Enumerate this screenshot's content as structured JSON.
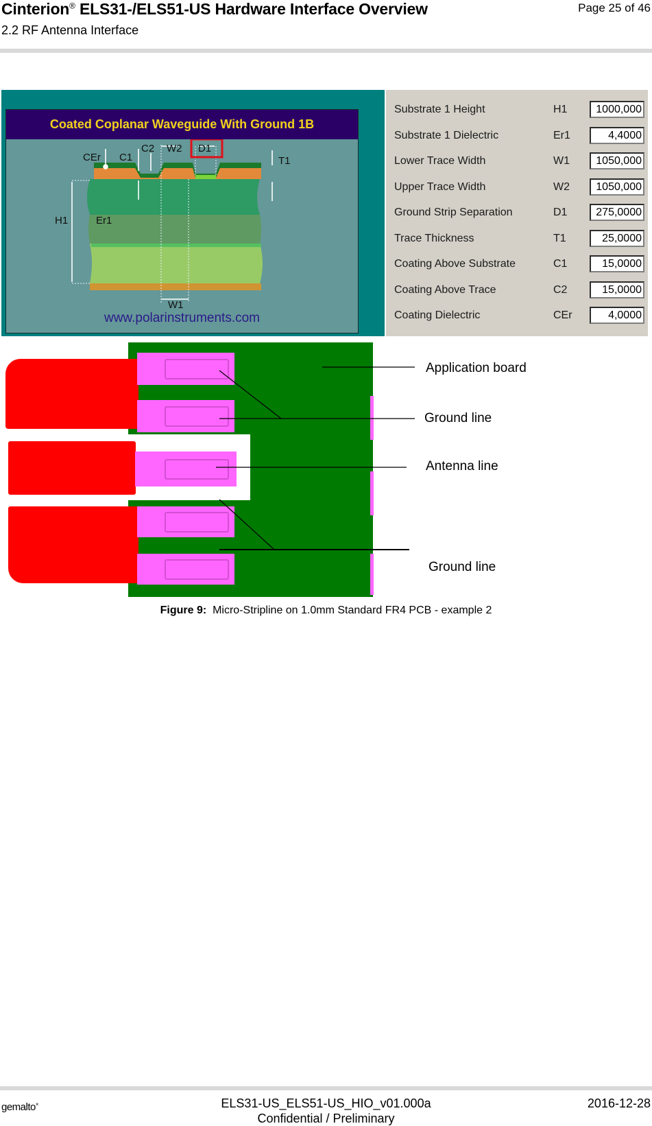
{
  "header": {
    "title_prefix": "Cinterion",
    "title_reg": "®",
    "title_suffix": " ELS31-/ELS51-US Hardware Interface Overview",
    "section": "2.2 RF Antenna Interface",
    "page": "Page 25 of 46"
  },
  "polar_panel": {
    "banner": "Coated Coplanar Waveguide With Ground 1B",
    "url": "www.polarinstruments.com",
    "diagram_labels": {
      "cer": "CEr",
      "c1": "C1",
      "c2": "C2",
      "w2": "W2",
      "d1": "D1",
      "t1": "T1",
      "h1": "H1",
      "er1": "Er1",
      "w1": "W1"
    },
    "parameters": [
      {
        "label": "Substrate 1 Height",
        "symbol": "H1",
        "value": "1000,000"
      },
      {
        "label": "Substrate 1 Dielectric",
        "symbol": "Er1",
        "value": "4,4000"
      },
      {
        "label": "Lower Trace Width",
        "symbol": "W1",
        "value": "1050,000"
      },
      {
        "label": "Upper Trace Width",
        "symbol": "W2",
        "value": "1050,000"
      },
      {
        "label": "Ground Strip Separation",
        "symbol": "D1",
        "value": "275,0000"
      },
      {
        "label": "Trace Thickness",
        "symbol": "T1",
        "value": "25,0000"
      },
      {
        "label": "Coating Above Substrate",
        "symbol": "C1",
        "value": "15,0000"
      },
      {
        "label": "Coating Above Trace",
        "symbol": "C2",
        "value": "15,0000"
      },
      {
        "label": "Coating Dielectric",
        "symbol": "CEr",
        "value": "4,0000"
      }
    ]
  },
  "pcb_diagram": {
    "callouts": {
      "application_board": "Application board",
      "ground_line_top": "Ground line",
      "antenna_line": "Antenna line",
      "ground_line_bottom": "Ground line"
    },
    "colors": {
      "board": "#007a00",
      "module": "#ff0000",
      "pad": "#ff66ff"
    }
  },
  "caption": {
    "label": "Figure 9:",
    "text": "Micro-Stripline on 1.0mm Standard FR4 PCB - example 2"
  },
  "footer": {
    "logo": "gemalto",
    "logo_mark": "×",
    "doc_id": "ELS31-US_ELS51-US_HIO_v01.000a",
    "confidentiality": "Confidential / Preliminary",
    "date": "2016-12-28"
  }
}
